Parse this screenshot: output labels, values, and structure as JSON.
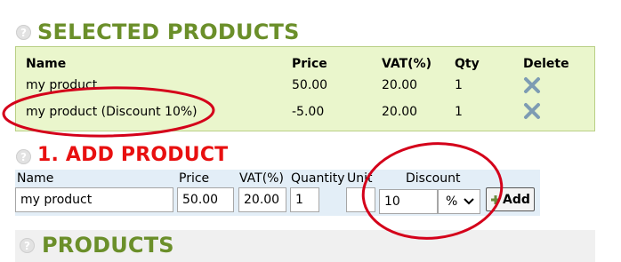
{
  "selected": {
    "title": "SELECTED PRODUCTS",
    "headers": {
      "name": "Name",
      "price": "Price",
      "vat": "VAT(%)",
      "qty": "Qty",
      "delete": "Delete"
    },
    "rows": [
      {
        "name": "my product",
        "price": "50.00",
        "vat": "20.00",
        "qty": "1"
      },
      {
        "name": "my product (Discount 10%)",
        "price": "-5.00",
        "vat": "20.00",
        "qty": "1"
      }
    ]
  },
  "add": {
    "title": "1. ADD PRODUCT",
    "labels": {
      "name": "Name",
      "price": "Price",
      "vat": "VAT(%)",
      "quantity": "Quantity",
      "unit": "Unit",
      "discount": "Discount"
    },
    "values": {
      "name": "my product",
      "price": "50.00",
      "vat": "20.00",
      "quantity": "1",
      "unit": "",
      "discount": "10"
    },
    "discount_type": "%",
    "add_label": "Add"
  },
  "products": {
    "title": "PRODUCTS"
  },
  "help_glyph": "?",
  "icons": {
    "help": "question-circle-icon",
    "delete": "x-cross-icon",
    "add": "plus-icon",
    "dropdown": "chevron-down-icon"
  },
  "colors": {
    "section_green": "#6b8f2a",
    "section_red": "#e81010",
    "delete_blue": "#7e9cb3",
    "annotation_red": "#d4001a",
    "panel_green": "#eaf6cc",
    "strip_blue": "#e3eef7"
  }
}
